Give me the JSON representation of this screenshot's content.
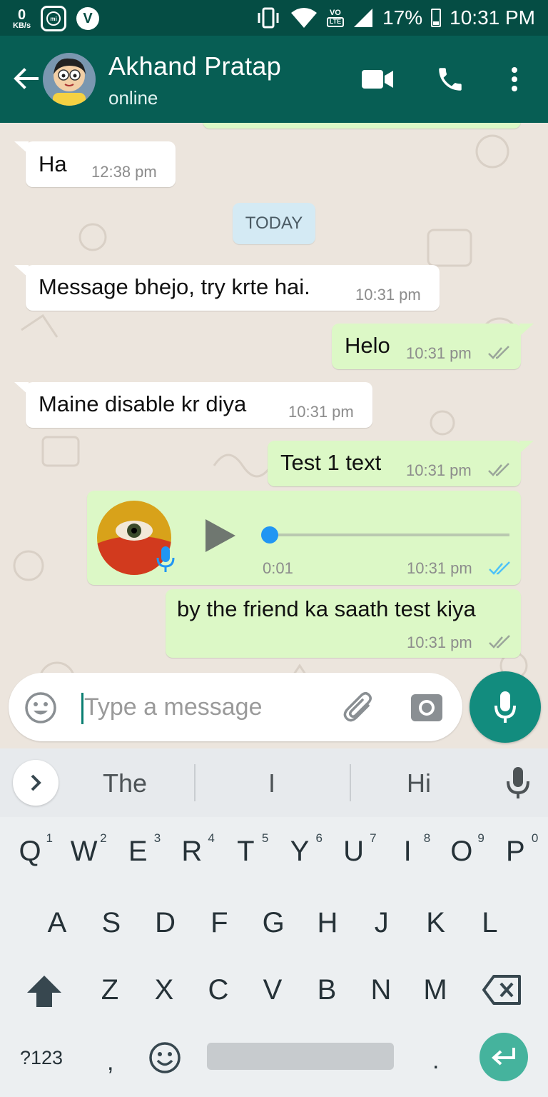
{
  "status_bar": {
    "net_speed_value": "0",
    "net_speed_unit": "KB/s",
    "mi_label": "mi",
    "v_label": "V",
    "lte_top": "VO",
    "lte_bottom": "LTE",
    "battery": "17%",
    "time": "10:31 PM"
  },
  "header": {
    "contact_name": "Akhand Pratap",
    "contact_status": "online",
    "icons": [
      "back-arrow-icon",
      "video-call-icon",
      "voice-call-icon",
      "more-vert-icon"
    ]
  },
  "chat": {
    "messages": [
      {
        "direction": "in",
        "text": "Ha",
        "time": "12:38 pm"
      },
      {
        "direction": "date",
        "text": "TODAY"
      },
      {
        "direction": "in",
        "text": "Message bhejo, try krte hai.",
        "time": "10:31 pm"
      },
      {
        "direction": "out",
        "text": "Helo",
        "time": "10:31 pm",
        "status": "delivered"
      },
      {
        "direction": "in",
        "text": "Maine disable kr diya",
        "time": "10:31 pm"
      },
      {
        "direction": "out",
        "text": "Test 1 text",
        "time": "10:31 pm",
        "status": "delivered"
      },
      {
        "direction": "out",
        "type": "voice",
        "duration": "0:01",
        "time": "10:31 pm",
        "status": "read",
        "progress": 0.0
      },
      {
        "direction": "out",
        "text": "by the friend ka saath test kiya",
        "time": "10:31 pm",
        "status": "delivered"
      }
    ]
  },
  "composer": {
    "placeholder": "Type a message",
    "value": ""
  },
  "keyboard": {
    "suggestions": [
      "The",
      "I",
      "Hi"
    ],
    "row1": [
      {
        "k": "Q",
        "n": "1"
      },
      {
        "k": "W",
        "n": "2"
      },
      {
        "k": "E",
        "n": "3"
      },
      {
        "k": "R",
        "n": "4"
      },
      {
        "k": "T",
        "n": "5"
      },
      {
        "k": "Y",
        "n": "6"
      },
      {
        "k": "U",
        "n": "7"
      },
      {
        "k": "I",
        "n": "8"
      },
      {
        "k": "O",
        "n": "9"
      },
      {
        "k": "P",
        "n": "0"
      }
    ],
    "row2": [
      "A",
      "S",
      "D",
      "F",
      "G",
      "H",
      "J",
      "K",
      "L"
    ],
    "row3": [
      "Z",
      "X",
      "C",
      "V",
      "B",
      "N",
      "M"
    ],
    "symbols_key": "?123",
    "comma_key": ",",
    "period_key": "."
  },
  "colors": {
    "header": "#075e54",
    "status_bar": "#054d44",
    "outgoing_bubble": "#dcf8c6",
    "incoming_bubble": "#ffffff",
    "read_tick": "#4fc3f7",
    "accent": "#128c7e"
  }
}
